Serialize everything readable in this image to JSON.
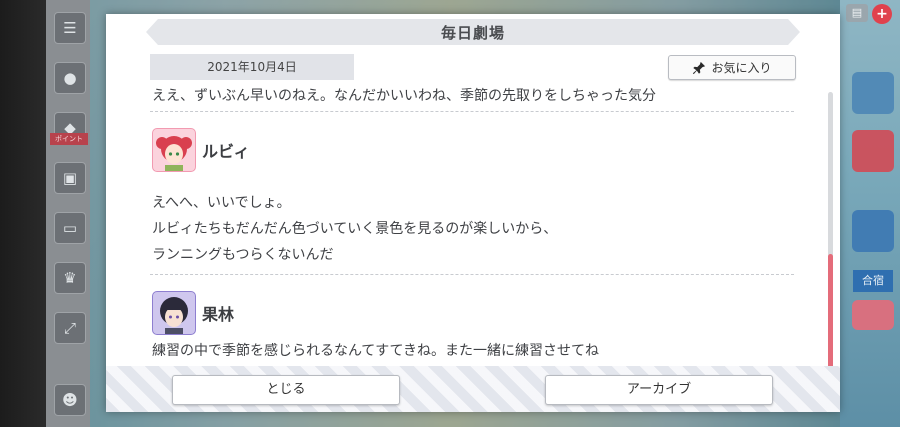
{
  "dialog": {
    "title": "毎日劇場",
    "date": "2021年10月4日",
    "favorite_label": "お気に入り"
  },
  "log": {
    "cut_line": "ええ、ずいぶん早いのねえ。なんだかいいわね、季節の先取りをしちゃった気分",
    "entries": [
      {
        "speaker": "ルビィ",
        "lines": [
          "えへへ、いいでしょ。",
          "ルビィたちもだんだん色づいていく景色を見るのが楽しいから、",
          "ランニングもつらくないんだ"
        ]
      },
      {
        "speaker": "果林",
        "lines": [
          "練習の中で季節を感じられるなんてすてきね。また一緒に練習させてね"
        ]
      }
    ]
  },
  "footer": {
    "close_label": "とじる",
    "archive_label": "アーカイブ"
  },
  "background": {
    "side_ribbon": "ポイント",
    "right_tag": "合宿"
  },
  "colors": {
    "scroll_thumb": "#e46c7a",
    "ruby_avatar": "#f7a8bd",
    "karin_avatar": "#a79ad9"
  }
}
